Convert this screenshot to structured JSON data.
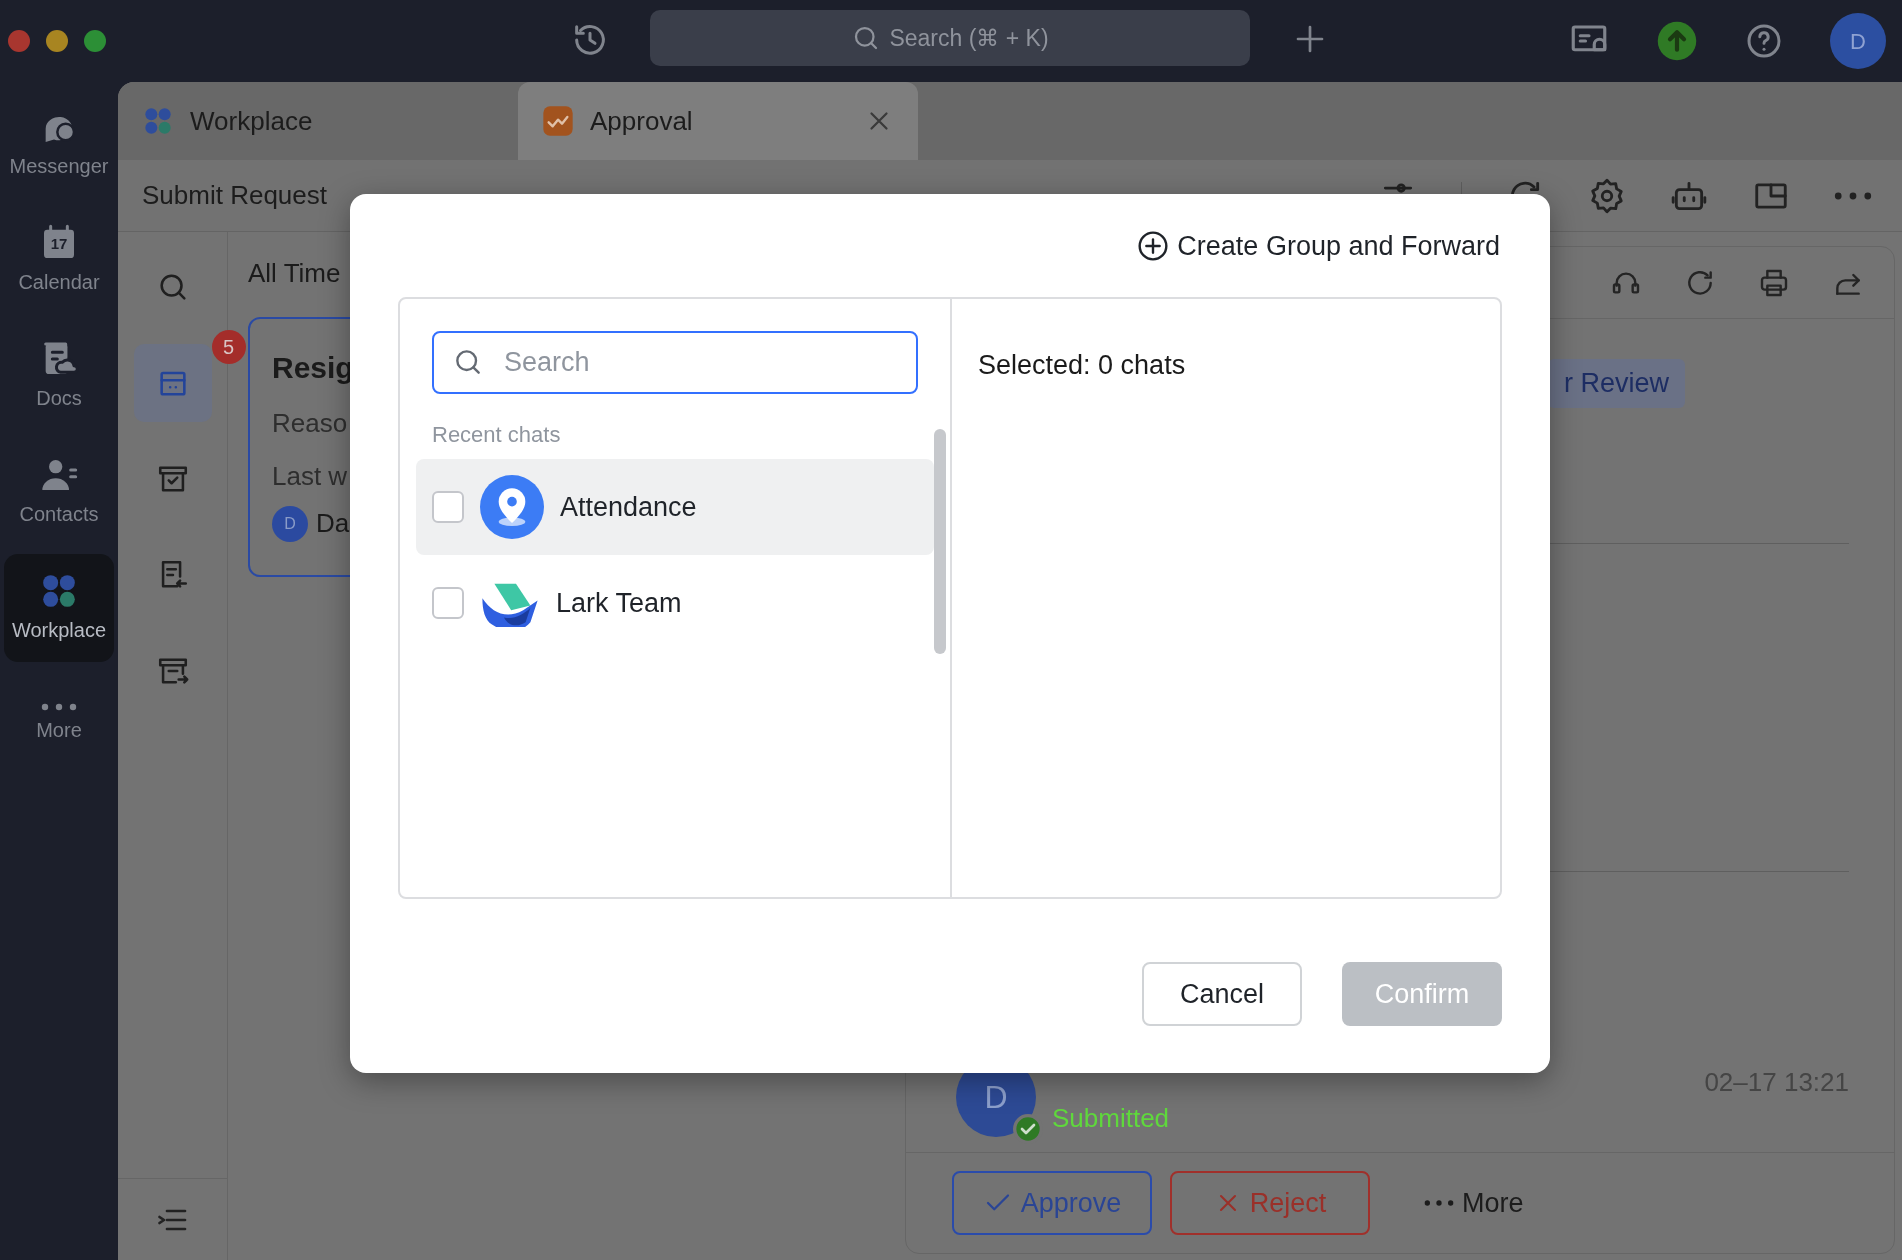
{
  "top_bar": {
    "search": {
      "placeholder": "Search (⌘ + K)"
    },
    "avatar": "D"
  },
  "nav_rail": [
    {
      "label": "Messenger",
      "kind": "messenger",
      "selected": false
    },
    {
      "label": "Calendar",
      "kind": "calendar",
      "selected": false,
      "date": "17"
    },
    {
      "label": "Docs",
      "kind": "docs",
      "selected": false
    },
    {
      "label": "Contacts",
      "kind": "contacts",
      "selected": false
    },
    {
      "label": "Workplace",
      "kind": "workplace",
      "selected": true
    },
    {
      "label": "More",
      "kind": "more",
      "selected": false
    }
  ],
  "tabs": [
    {
      "label": "Workplace",
      "kind": "workplace",
      "selected": false,
      "closable": false
    },
    {
      "label": "Approval",
      "kind": "approval",
      "selected": true,
      "closable": true
    }
  ],
  "subnav": [
    {
      "label": "Submit Request",
      "selected": false
    }
  ],
  "tools": [
    {
      "kind": "search",
      "selected": false
    },
    {
      "kind": "inbox",
      "selected": true,
      "badge": "5"
    },
    {
      "kind": "archive",
      "selected": false
    },
    {
      "kind": "document",
      "selected": false
    },
    {
      "kind": "outbox",
      "selected": false
    }
  ],
  "list": {
    "filter": "All Time",
    "card": {
      "title": "Resig",
      "lines": [
        "Reaso",
        "Last w"
      ],
      "avatar": "D",
      "name": "Da"
    }
  },
  "detail": {
    "status_tag": "r Review",
    "timeline": {
      "avatar": "D",
      "status": "Submitted",
      "time": "02–17 13:21"
    },
    "actions": [
      {
        "kind": "approve",
        "label": "Approve"
      },
      {
        "kind": "reject",
        "label": "Reject"
      },
      {
        "kind": "more",
        "label": "More"
      }
    ]
  },
  "dialog": {
    "create_link": "Create Group and Forward",
    "search": {
      "placeholder": "Search"
    },
    "section": "Recent chats",
    "chats": [
      {
        "name": "Attendance",
        "kind": "attendance",
        "checked": false,
        "hovered": true
      },
      {
        "name": "Lark Team",
        "kind": "lark",
        "checked": false,
        "hovered": false
      }
    ],
    "selected_summary": "Selected: 0 chats",
    "buttons": [
      {
        "label": "Cancel",
        "kind": "secondary",
        "disabled": false
      },
      {
        "label": "Confirm",
        "kind": "primary",
        "disabled": true
      }
    ]
  }
}
